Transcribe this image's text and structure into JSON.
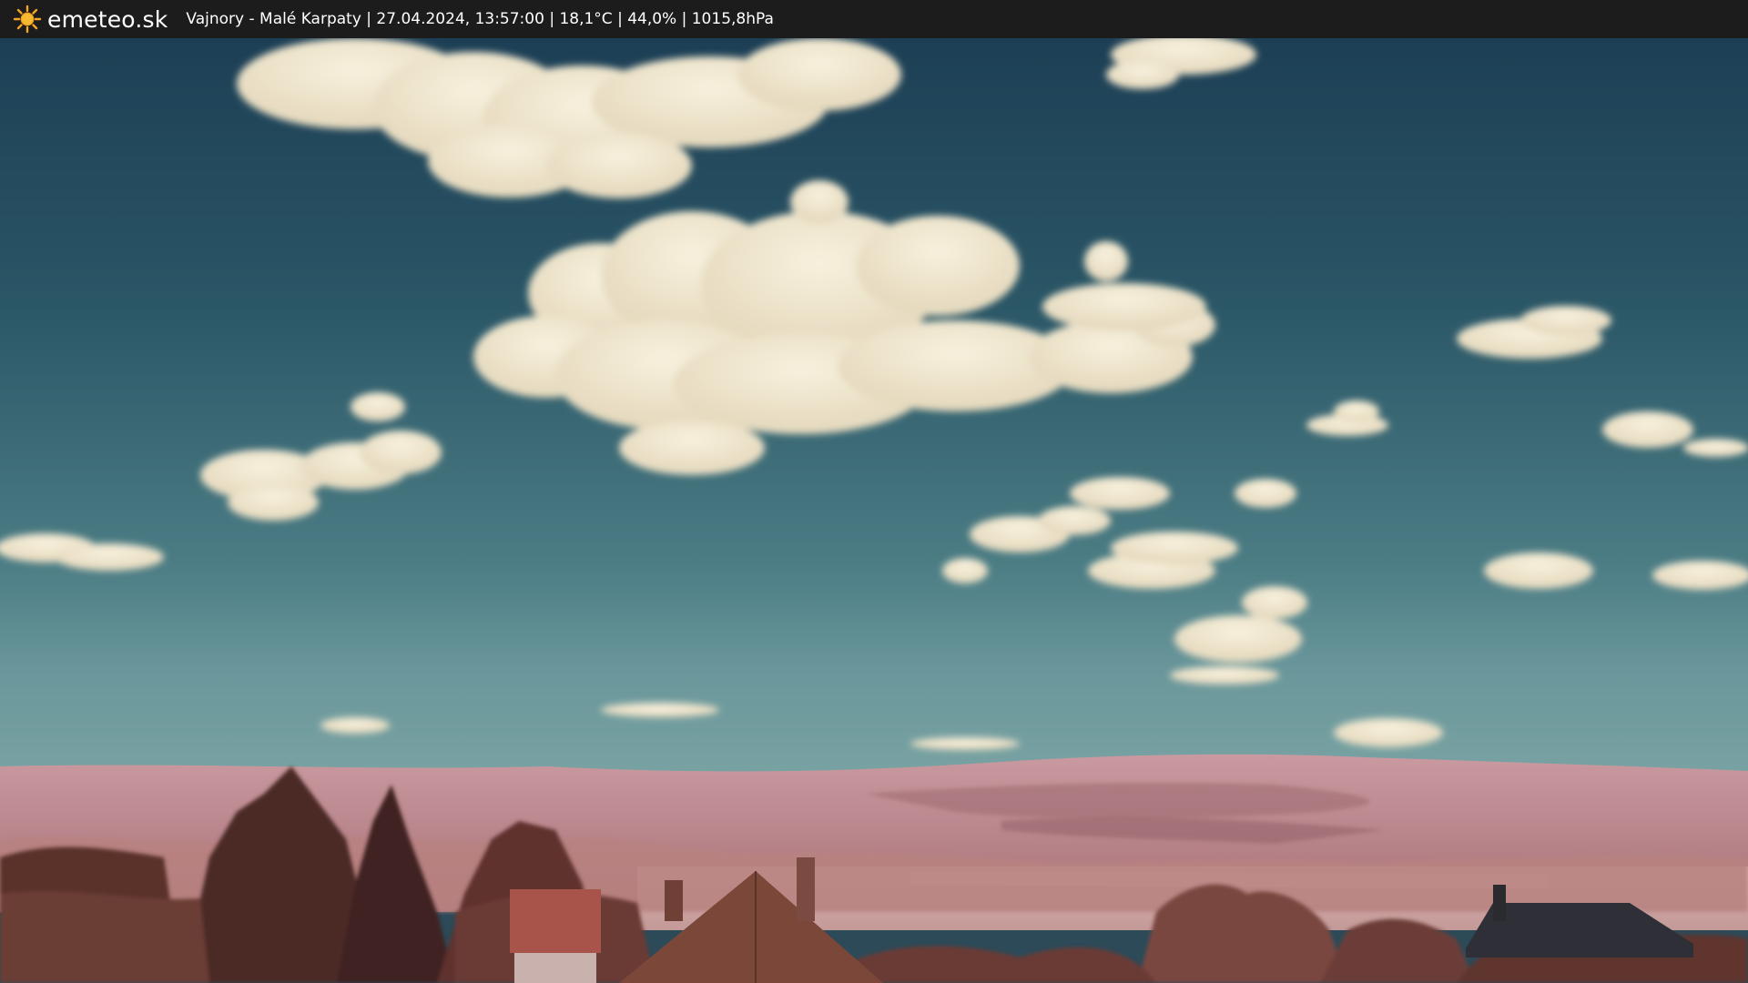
{
  "header": {
    "logo_text": "emeteo.sk",
    "logo_icon": "sun-icon",
    "caption": "Vajnory - Malé Karpaty | 27.04.2024, 13:57:00 | 18,1°C | 44,0% | 1015,8hPa"
  },
  "colors": {
    "bar_background": "#1c1c1c",
    "sun": "#f5a623",
    "sky_top": "#1d3f55",
    "sky_horizon": "#5f8f95",
    "cloud": "#f2ead2",
    "hills": "#c8959a",
    "trees": "#6a3a34"
  }
}
